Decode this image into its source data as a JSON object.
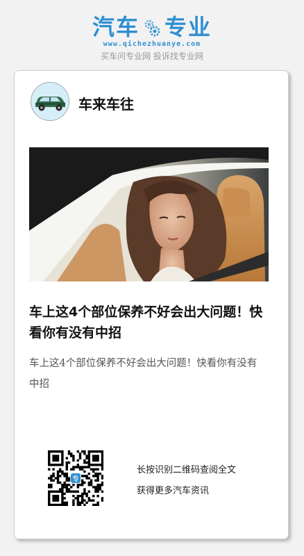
{
  "brand": {
    "name_left": "汽车",
    "name_right": "专业",
    "url": "www.qichezhuanye.com",
    "slogan": "买车问专业网 投诉找专业网",
    "color": "#2f8fd1"
  },
  "card": {
    "author": "车来车往",
    "avatar_icon": "car-icon",
    "headline": "车上这4个部位保养不好会出大问题！快看你有没有中招",
    "summary": "车上这4个部位保养不好会出大问题！快看你有没有中招",
    "qr_hint_line1": "长按识别二维码查阅全文",
    "qr_hint_line2": "获得更多汽车资讯",
    "qr_center_glyph": "专"
  }
}
